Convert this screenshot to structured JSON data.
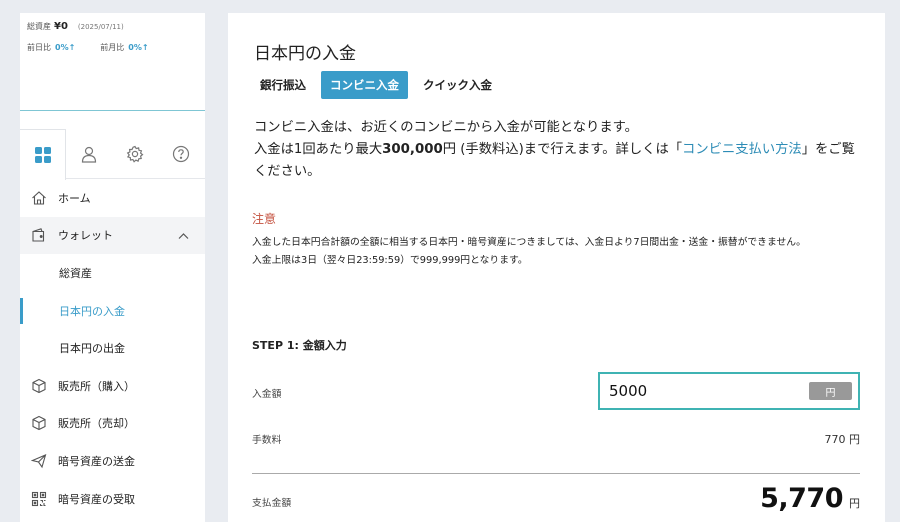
{
  "summary": {
    "total_assets_label": "総資産",
    "total_assets_value": "¥0",
    "date": "(2025/07/11)",
    "day_change_label": "前日比",
    "day_change_value": "0%↑",
    "month_change_label": "前月比",
    "month_change_value": "0%↑"
  },
  "sidebar_tabs": [
    {
      "icon": "dashboard-icon",
      "active": true
    },
    {
      "icon": "user-icon",
      "active": false
    },
    {
      "icon": "gear-icon",
      "active": false
    },
    {
      "icon": "help-icon",
      "active": false
    }
  ],
  "nav": {
    "home": "ホーム",
    "wallet": "ウォレット",
    "total_assets": "総資産",
    "jpy_deposit": "日本円の入金",
    "jpy_withdraw": "日本円の出金",
    "buy": "販売所（購入）",
    "sell": "販売所（売却）",
    "crypto_send": "暗号資産の送金",
    "crypto_receive": "暗号資産の受取"
  },
  "main": {
    "title": "日本円の入金",
    "tabs": [
      "銀行振込",
      "コンビニ入金",
      "クイック入金"
    ],
    "active_tab": "コンビニ入金",
    "intro_line1": "コンビニ入金は、お近くのコンビニから入金が可能となります。",
    "intro_line2_a": "入金は1回あたり最大",
    "intro_line2_amount": "300,000",
    "intro_line2_b": "円 (手数料込)まで行えます。詳しくは「",
    "intro_link": "コンビニ支払い方法",
    "intro_line2_c": "」をご覧ください。",
    "notice_title": "注意",
    "notice_line1": "入金した日本円合計額の全額に相当する日本円・暗号資産につきましては、入金日より7日間出金・送金・振替ができません。",
    "notice_line2": "入金上限は3日（翌々日23:59:59）で999,999円となります。",
    "step_title": "STEP 1: 金額入力",
    "amount_label": "入金額",
    "amount_value": "5000",
    "amount_unit": "円",
    "fee_label": "手数料",
    "fee_value": "770 円",
    "total_label": "支払金額",
    "total_value": "5,770",
    "total_unit": "円"
  },
  "colors": {
    "accent": "#3a9cc9",
    "input_border": "#3fb3b3",
    "notice": "#c4513f"
  }
}
